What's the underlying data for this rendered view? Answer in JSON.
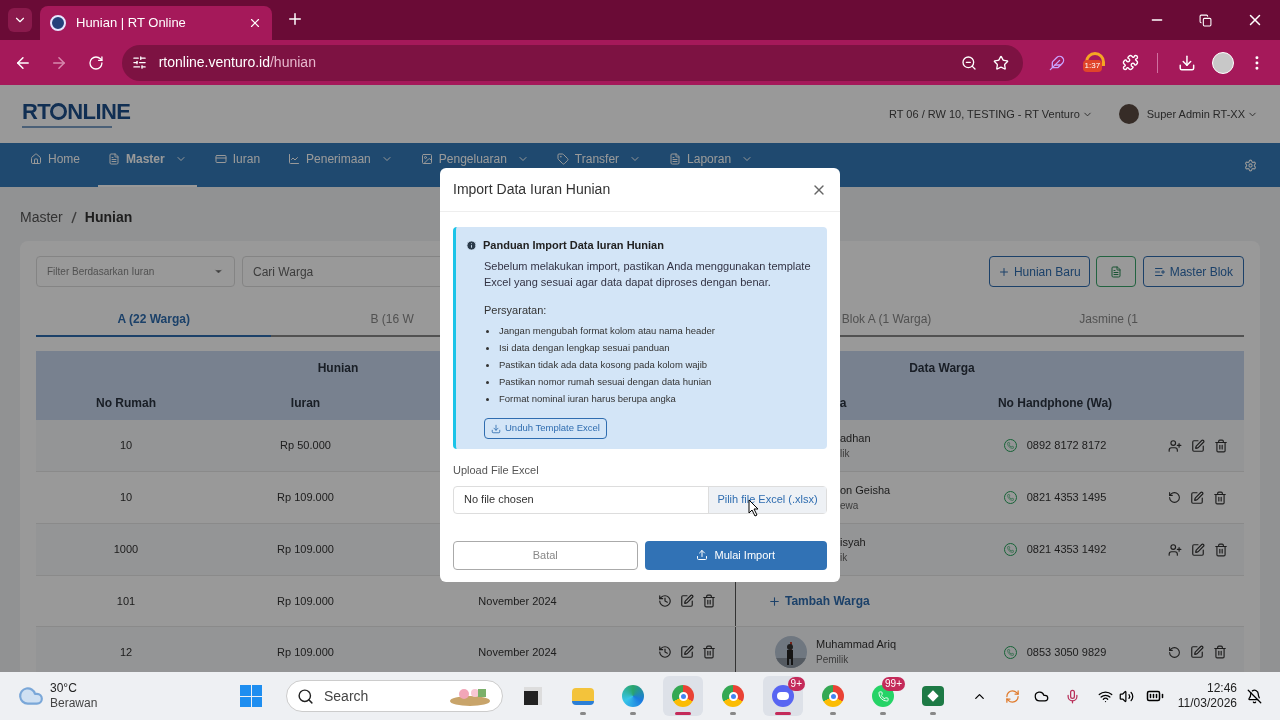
{
  "browser": {
    "tab_title": "Hunian | RT Online",
    "url_host": "rtonline.venturo.id",
    "url_path": "/hunian",
    "extension_badge": "1:37"
  },
  "app": {
    "logo_left": "RT",
    "logo_right": "NLINE",
    "community": "RT 06 / RW 10, TESTING - RT Venturo",
    "user": "Super Admin RT-XX"
  },
  "nav": [
    {
      "label": "Home",
      "selected": false,
      "dropdown": false
    },
    {
      "label": "Master",
      "selected": true,
      "dropdown": true
    },
    {
      "label": "Iuran",
      "selected": false,
      "dropdown": false
    },
    {
      "label": "Penerimaan",
      "selected": false,
      "dropdown": true
    },
    {
      "label": "Pengeluaran",
      "selected": false,
      "dropdown": true
    },
    {
      "label": "Transfer",
      "selected": false,
      "dropdown": true
    },
    {
      "label": "Laporan",
      "selected": false,
      "dropdown": true
    }
  ],
  "breadcrumb": [
    {
      "label": "Master",
      "current": false
    },
    {
      "label": "Hunian",
      "current": true
    }
  ],
  "toolbar": {
    "filter_placeholder": "Filter Berdasarkan Iuran",
    "search_placeholder": "Cari Warga",
    "add_button": "Hunian Baru",
    "master_button": "Master Blok"
  },
  "tabs": [
    {
      "label": "A (22 Warga)",
      "selected": true
    },
    {
      "label": "B (16 W",
      "selected": false
    },
    {
      "label": "Blok A (1 Warga)",
      "selected": false
    },
    {
      "label": "Jasmine (1",
      "selected": false
    }
  ],
  "table": {
    "groups": [
      "Hunian",
      "Data Warga"
    ],
    "columns": [
      "No Rumah",
      "Iuran",
      "a",
      "No Handphone (Wa)"
    ],
    "rows": [
      {
        "no": "10",
        "iuran": "Rp 50.000",
        "name": "adhan",
        "role": "lik",
        "phone": "0892 8172 8172",
        "kind": "add"
      },
      {
        "no": "10",
        "iuran": "Rp 109.000",
        "name": "on Geisha",
        "role": "ewa",
        "phone": "0821 4353 1495",
        "kind": "reset"
      },
      {
        "no": "1000",
        "iuran": "Rp 109.000",
        "name": "isyah",
        "role": "ik",
        "phone": "0821 4353 1492",
        "kind": "add"
      },
      {
        "no": "101",
        "iuran": "Rp 109.000",
        "periode": "November 2024",
        "add_resident": "Tambah Warga"
      },
      {
        "no": "12",
        "iuran": "Rp 109.000",
        "periode": "November 2024",
        "name": "Muhammad Ariq",
        "role": "Pemilik",
        "photo": true,
        "phone": "0853 3050 9829",
        "kind": "reset"
      }
    ]
  },
  "modal": {
    "title": "Import Data Iuran Hunian",
    "guide_title": "Panduan Import Data Iuran Hunian",
    "guide_text": "Sebelum melakukan import, pastikan Anda menggunakan template Excel yang sesuai agar data dapat diproses dengan benar.",
    "requirements_title": "Persyaratan:",
    "requirements": [
      "Jangan mengubah format kolom atau nama header",
      "Isi data dengan lengkap sesuai panduan",
      "Pastikan tidak ada data kosong pada kolom wajib",
      "Pastikan nomor rumah sesuai dengan data hunian",
      "Format nominal iuran harus berupa angka"
    ],
    "download_button": "Unduh Template Excel",
    "upload_label": "Upload File Excel",
    "file_status": "No file chosen",
    "choose_button": "Pilih file Excel (.xlsx)",
    "cancel_button": "Batal",
    "submit_button": "Mulai Import"
  },
  "taskbar": {
    "temperature": "30°C",
    "weather": "Berawan",
    "search_placeholder": "Search",
    "apps": [
      {
        "kind": "taskview",
        "active": false
      },
      {
        "kind": "explorer",
        "active": false
      },
      {
        "kind": "edge",
        "active": false
      },
      {
        "kind": "chrome",
        "active": true
      },
      {
        "kind": "chrome",
        "active": false
      },
      {
        "kind": "discord",
        "active": true,
        "badge": "9+"
      },
      {
        "kind": "chrome",
        "active": false
      },
      {
        "kind": "whatsapp",
        "active": false,
        "badge": "99+"
      },
      {
        "kind": "excel",
        "active": false
      }
    ],
    "time": "12:46",
    "date": "11/03/2026"
  }
}
